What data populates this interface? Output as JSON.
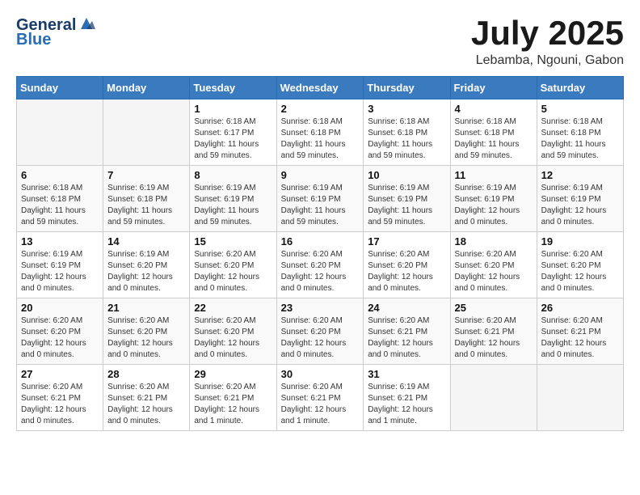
{
  "header": {
    "logo_general": "General",
    "logo_blue": "Blue",
    "month": "July 2025",
    "location": "Lebamba, Ngouni, Gabon"
  },
  "weekdays": [
    "Sunday",
    "Monday",
    "Tuesday",
    "Wednesday",
    "Thursday",
    "Friday",
    "Saturday"
  ],
  "weeks": [
    [
      {
        "day": "",
        "info": ""
      },
      {
        "day": "",
        "info": ""
      },
      {
        "day": "1",
        "info": "Sunrise: 6:18 AM\nSunset: 6:17 PM\nDaylight: 11 hours\nand 59 minutes."
      },
      {
        "day": "2",
        "info": "Sunrise: 6:18 AM\nSunset: 6:18 PM\nDaylight: 11 hours\nand 59 minutes."
      },
      {
        "day": "3",
        "info": "Sunrise: 6:18 AM\nSunset: 6:18 PM\nDaylight: 11 hours\nand 59 minutes."
      },
      {
        "day": "4",
        "info": "Sunrise: 6:18 AM\nSunset: 6:18 PM\nDaylight: 11 hours\nand 59 minutes."
      },
      {
        "day": "5",
        "info": "Sunrise: 6:18 AM\nSunset: 6:18 PM\nDaylight: 11 hours\nand 59 minutes."
      }
    ],
    [
      {
        "day": "6",
        "info": "Sunrise: 6:18 AM\nSunset: 6:18 PM\nDaylight: 11 hours\nand 59 minutes."
      },
      {
        "day": "7",
        "info": "Sunrise: 6:19 AM\nSunset: 6:18 PM\nDaylight: 11 hours\nand 59 minutes."
      },
      {
        "day": "8",
        "info": "Sunrise: 6:19 AM\nSunset: 6:19 PM\nDaylight: 11 hours\nand 59 minutes."
      },
      {
        "day": "9",
        "info": "Sunrise: 6:19 AM\nSunset: 6:19 PM\nDaylight: 11 hours\nand 59 minutes."
      },
      {
        "day": "10",
        "info": "Sunrise: 6:19 AM\nSunset: 6:19 PM\nDaylight: 11 hours\nand 59 minutes."
      },
      {
        "day": "11",
        "info": "Sunrise: 6:19 AM\nSunset: 6:19 PM\nDaylight: 12 hours\nand 0 minutes."
      },
      {
        "day": "12",
        "info": "Sunrise: 6:19 AM\nSunset: 6:19 PM\nDaylight: 12 hours\nand 0 minutes."
      }
    ],
    [
      {
        "day": "13",
        "info": "Sunrise: 6:19 AM\nSunset: 6:19 PM\nDaylight: 12 hours\nand 0 minutes."
      },
      {
        "day": "14",
        "info": "Sunrise: 6:19 AM\nSunset: 6:20 PM\nDaylight: 12 hours\nand 0 minutes."
      },
      {
        "day": "15",
        "info": "Sunrise: 6:20 AM\nSunset: 6:20 PM\nDaylight: 12 hours\nand 0 minutes."
      },
      {
        "day": "16",
        "info": "Sunrise: 6:20 AM\nSunset: 6:20 PM\nDaylight: 12 hours\nand 0 minutes."
      },
      {
        "day": "17",
        "info": "Sunrise: 6:20 AM\nSunset: 6:20 PM\nDaylight: 12 hours\nand 0 minutes."
      },
      {
        "day": "18",
        "info": "Sunrise: 6:20 AM\nSunset: 6:20 PM\nDaylight: 12 hours\nand 0 minutes."
      },
      {
        "day": "19",
        "info": "Sunrise: 6:20 AM\nSunset: 6:20 PM\nDaylight: 12 hours\nand 0 minutes."
      }
    ],
    [
      {
        "day": "20",
        "info": "Sunrise: 6:20 AM\nSunset: 6:20 PM\nDaylight: 12 hours\nand 0 minutes."
      },
      {
        "day": "21",
        "info": "Sunrise: 6:20 AM\nSunset: 6:20 PM\nDaylight: 12 hours\nand 0 minutes."
      },
      {
        "day": "22",
        "info": "Sunrise: 6:20 AM\nSunset: 6:20 PM\nDaylight: 12 hours\nand 0 minutes."
      },
      {
        "day": "23",
        "info": "Sunrise: 6:20 AM\nSunset: 6:20 PM\nDaylight: 12 hours\nand 0 minutes."
      },
      {
        "day": "24",
        "info": "Sunrise: 6:20 AM\nSunset: 6:21 PM\nDaylight: 12 hours\nand 0 minutes."
      },
      {
        "day": "25",
        "info": "Sunrise: 6:20 AM\nSunset: 6:21 PM\nDaylight: 12 hours\nand 0 minutes."
      },
      {
        "day": "26",
        "info": "Sunrise: 6:20 AM\nSunset: 6:21 PM\nDaylight: 12 hours\nand 0 minutes."
      }
    ],
    [
      {
        "day": "27",
        "info": "Sunrise: 6:20 AM\nSunset: 6:21 PM\nDaylight: 12 hours\nand 0 minutes."
      },
      {
        "day": "28",
        "info": "Sunrise: 6:20 AM\nSunset: 6:21 PM\nDaylight: 12 hours\nand 0 minutes."
      },
      {
        "day": "29",
        "info": "Sunrise: 6:20 AM\nSunset: 6:21 PM\nDaylight: 12 hours\nand 1 minute."
      },
      {
        "day": "30",
        "info": "Sunrise: 6:20 AM\nSunset: 6:21 PM\nDaylight: 12 hours\nand 1 minute."
      },
      {
        "day": "31",
        "info": "Sunrise: 6:19 AM\nSunset: 6:21 PM\nDaylight: 12 hours\nand 1 minute."
      },
      {
        "day": "",
        "info": ""
      },
      {
        "day": "",
        "info": ""
      }
    ]
  ]
}
